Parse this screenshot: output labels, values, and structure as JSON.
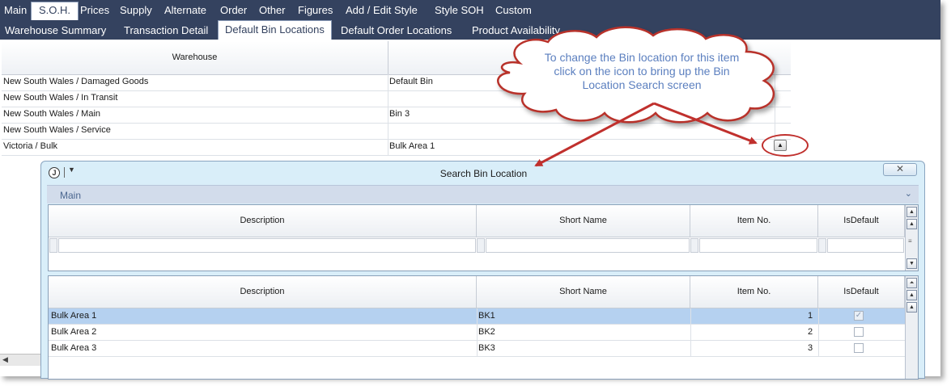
{
  "menu": {
    "items": [
      "Main",
      "S.O.H.",
      "Prices",
      "Supply",
      "Alternate",
      "Order",
      "Other",
      "Figures",
      "Add / Edit Style",
      "Style SOH",
      "Custom"
    ],
    "active": "S.O.H."
  },
  "tabs": {
    "items": [
      "Warehouse Summary",
      "Transaction Detail",
      "Default Bin Locations",
      "Default Order Locations",
      "Product Availability"
    ],
    "active": "Default Bin Locations"
  },
  "warehouse_grid": {
    "column_header": "Warehouse",
    "rows": [
      {
        "warehouse": "New South Wales / Damaged Goods",
        "bin": "Default Bin"
      },
      {
        "warehouse": "New South Wales / In Transit",
        "bin": ""
      },
      {
        "warehouse": "New South Wales / Main",
        "bin": "Bin 3"
      },
      {
        "warehouse": "New South Wales / Service",
        "bin": ""
      },
      {
        "warehouse": "Victoria / Bulk",
        "bin": "Bulk Area 1"
      }
    ],
    "lookup_icon": "up-triangle-icon"
  },
  "callout": {
    "line1": "To change the Bin location for this item",
    "line2": "click on the icon to bring up the Bin",
    "line3": "Location Search screen",
    "text_color": "#5b7fbf",
    "arrow_color": "#c0302d"
  },
  "dialog": {
    "title": "Search Bin Location",
    "logo": "J",
    "close_glyph": "✕",
    "section": "Main",
    "filter_grid": {
      "headers": [
        "Description",
        "Short Name",
        "Item No.",
        "IsDefault"
      ]
    },
    "results_grid": {
      "headers": [
        "Description",
        "Short Name",
        "Item No.",
        "IsDefault"
      ],
      "rows": [
        {
          "description": "Bulk Area 1",
          "short_name": "BK1",
          "item_no": "1",
          "is_default": true
        },
        {
          "description": "Bulk Area 2",
          "short_name": "BK2",
          "item_no": "2",
          "is_default": false
        },
        {
          "description": "Bulk Area 3",
          "short_name": "BK3",
          "item_no": "3",
          "is_default": false
        }
      ],
      "selected_row": 0
    }
  },
  "colors": {
    "menu_bg": "#34425f",
    "selection": "#b5d1f0",
    "dialog_bg": "#d9eef9"
  }
}
